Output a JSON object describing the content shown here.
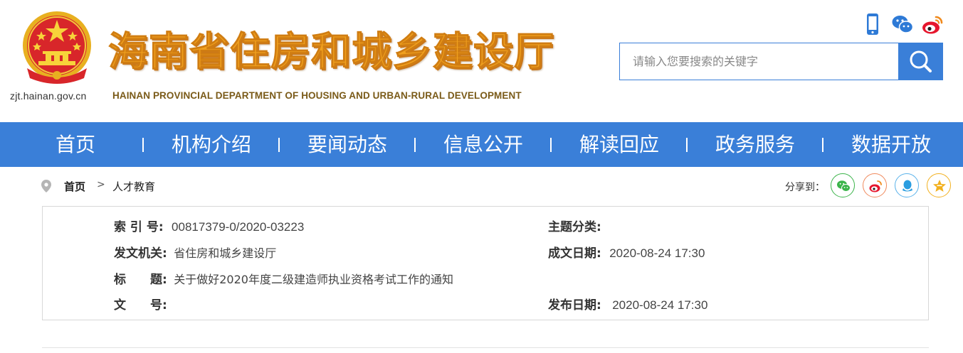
{
  "header": {
    "site_title": "海南省住房和城乡建设厅",
    "site_subtitle": "HAINAN PROVINCIAL DEPARTMENT OF HOUSING AND URBAN-RURAL DEVELOPMENT",
    "emblem_url": "zjt.hainan.gov.cn",
    "top_icons": [
      "mobile-icon",
      "wechat-icon",
      "weibo-icon"
    ],
    "search": {
      "placeholder": "请输入您要搜索的关键字",
      "value": ""
    }
  },
  "nav": {
    "items": [
      {
        "label": "首页"
      },
      {
        "label": "机构介绍"
      },
      {
        "label": "要闻动态"
      },
      {
        "label": "信息公开"
      },
      {
        "label": "解读回应"
      },
      {
        "label": "政务服务"
      },
      {
        "label": "数据开放"
      }
    ]
  },
  "breadcrumb": {
    "home": "首页",
    "separator": ">",
    "current": "人才教育"
  },
  "share": {
    "label": "分享到：",
    "targets": [
      "wechat-icon",
      "weibo-icon",
      "qq-icon",
      "qzone-icon"
    ]
  },
  "info": {
    "index_label": "索 引 号:",
    "index_value": "00817379-0/2020-03223",
    "topic_label": "主题分类:",
    "topic_value": "",
    "issuer_label": "发文机关:",
    "issuer_value": "省住房和城乡建设厅",
    "created_label": "成文日期:",
    "created_value": "2020-08-24 17:30",
    "title_label": "标　　题:",
    "title_value": "关于做好2020年度二级建造师执业资格考试工作的通知",
    "docno_label": "文　　号:",
    "docno_value": "",
    "published_label": "发布日期:",
    "published_value": "2020-08-24 17:30"
  },
  "colors": {
    "brand_blue": "#3a7fd8",
    "title_orange": "#f0a01e",
    "wechat_green": "#3bb44a",
    "weibo_red": "#e6162d",
    "qq_blue": "#2a9de0",
    "qzone_yellow": "#f2b01e"
  }
}
